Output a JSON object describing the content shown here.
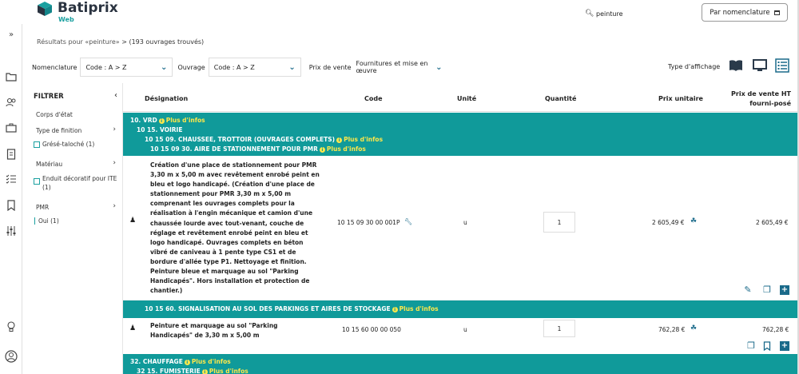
{
  "app": {
    "name": "Batiprix",
    "sub": "Web"
  },
  "search": {
    "value": "peinture",
    "placeholder": ""
  },
  "header": {
    "nomenclature_button": "Par nomenclature"
  },
  "breadcrumb": {
    "prefix": "Résultats pour «peinture»",
    "sep": ">",
    "count": "(193 ouvrages trouvés)"
  },
  "filters": {
    "nomenclature_label": "Nomenclature",
    "nomenclature_value": "Code : A > Z",
    "ouvrage_label": "Ouvrage",
    "ouvrage_value": "Code : A > Z",
    "prix_label": "Prix de vente",
    "prix_value": "Fournitures et mise en œuvre",
    "display_label": "Type d'affichage"
  },
  "filter_panel": {
    "title": "FILTRER",
    "groups": [
      {
        "label": "Corps d'état"
      },
      {
        "label": "Type de finition",
        "options": [
          "Grésé-taloché (1)"
        ]
      },
      {
        "label": "Matériau",
        "options": [
          "Enduit décoratif pour ITE (1)"
        ]
      },
      {
        "label": "PMR",
        "options": [
          "Oui (1)"
        ]
      }
    ]
  },
  "table": {
    "headers": {
      "designation": "Désignation",
      "code": "Code",
      "unite": "Unité",
      "quantite": "Quantité",
      "prix_unitaire": "Prix unitaire",
      "prix_vente": "Prix de vente HT fourni-posé"
    },
    "plus_infos": "Plus d'infos",
    "section1": {
      "l1": "10. VRD",
      "l2": "10 15. VOIRIE",
      "l3": "10 15 09. CHAUSSEE, TROTTOIR (OUVRAGES COMPLETS)",
      "l4": "10 15 09 30. AIRE DE STATIONNEMENT POUR PMR"
    },
    "row1": {
      "description": "Création d'une place de stationnement pour PMR 3,30 m x 5,00 m avec revêtement enrobé peint en bleu et logo handicapé. (Création d'une place de stationnement pour PMR 3,30 m x 5,00 m comprenant les ouvrages complets pour la réalisation à l'engin mécanique et camion d'une chaussée lourde avec tout-venant, couche de réglage et revêtement enrobé peint en bleu et logo handicapé. Ouvrages complets en béton vibré de caniveau à 1 pente type CS1 et de bordure d'allée type P1. Nettoyage et finition. Peinture bleue et marquage au sol \"Parking Handicapés\". Hors installation et protection de chantier.)",
      "code": "10 15 09 30 00 001P",
      "unite": "u",
      "quantite": "1",
      "prix_unitaire": "2 605,49 €",
      "prix_vente": "2 605,49 €"
    },
    "section2": {
      "l1": "10 15 60. SIGNALISATION AU SOL DES PARKINGS ET AIRES DE STOCKAGE"
    },
    "row2": {
      "description": "Peinture et marquage au sol \"Parking Handicapés\" de 3,30 m x 5,00 m",
      "code": "10 15 60 00 00 050",
      "unite": "u",
      "quantite": "1",
      "prix_unitaire": "762,28 €",
      "prix_vente": "762,28 €"
    },
    "section3": {
      "l1": "32. CHAUFFAGE",
      "l2": "32 15. FUMISTERIE"
    }
  }
}
